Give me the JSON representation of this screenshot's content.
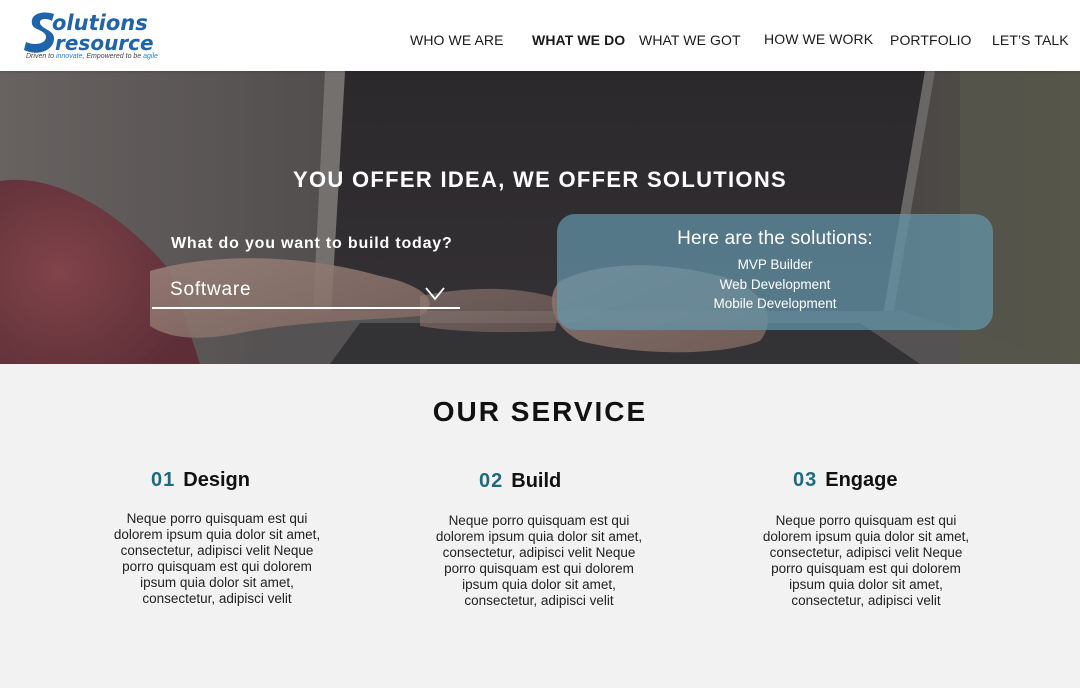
{
  "header": {
    "logo_word_top": "olutions",
    "logo_word_bottom": "resource",
    "logo_tag_1": "Driven to ",
    "logo_tag_2": "innovate",
    "logo_tag_3": ", Empowered to be ",
    "logo_tag_4": "agile",
    "nav": [
      {
        "label": "WHO WE ARE"
      },
      {
        "label": "WHAT WE DO"
      },
      {
        "label": "WHAT WE GOT"
      },
      {
        "label": "HOW WE WORK"
      },
      {
        "label": "PORTFOLIO"
      },
      {
        "label": "LET’S TALK"
      }
    ],
    "active_nav": "WHAT WE DO"
  },
  "hero": {
    "title": "YOU OFFER IDEA, WE OFFER SOLUTIONS",
    "build_label": "What do you want to build today?",
    "select_value": "Software",
    "solutions_title": "Here are the solutions:",
    "solutions": [
      "MVP Builder",
      "Web Development",
      "Mobile Development"
    ]
  },
  "service": {
    "title": "OUR SERVICE",
    "items": [
      {
        "num": "01",
        "name": "Design",
        "body": "Neque porro quisquam est qui dolorem ipsum quia dolor sit amet, consectetur, adipisci velit Neque porro quisquam est qui dolorem ipsum quia dolor sit amet, consectetur, adipisci velit"
      },
      {
        "num": "02",
        "name": "Build",
        "body": "Neque porro quisquam est qui dolorem ipsum quia dolor sit amet, consectetur, adipisci velit Neque porro quisquam est qui dolorem ipsum quia dolor sit amet, consectetur, adipisci velit"
      },
      {
        "num": "03",
        "name": "Engage",
        "body": "Neque porro quisquam est qui dolorem ipsum quia dolor sit amet, consectetur, adipisci velit Neque porro quisquam est qui dolorem ipsum quia dolor sit amet, consectetur, adipisci velit"
      }
    ]
  },
  "colors": {
    "brand_blue": "#1f63a8",
    "accent_teal": "#1c6a7e",
    "panel": "#6496aa",
    "page_bg": "#f2f2f2"
  },
  "icons": {
    "logo": "solutions-resource-logo",
    "dropdown": "chevron-down-icon"
  }
}
